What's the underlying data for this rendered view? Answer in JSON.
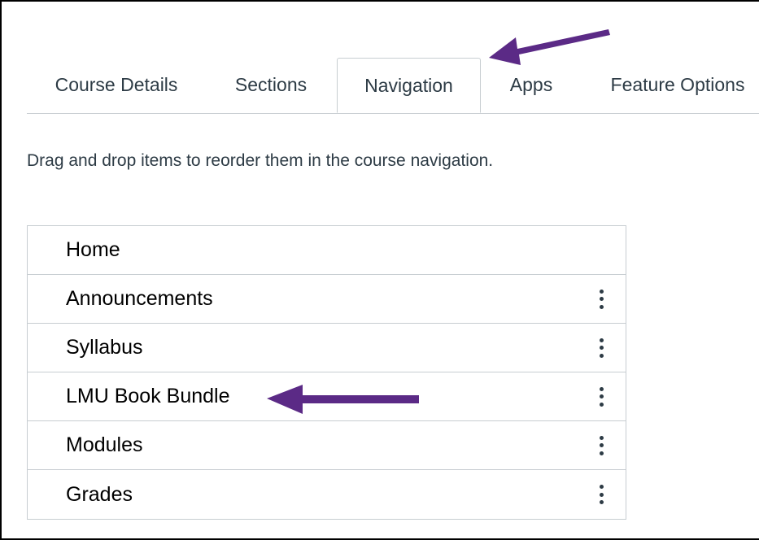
{
  "tabs": [
    {
      "label": "Course Details",
      "active": false
    },
    {
      "label": "Sections",
      "active": false
    },
    {
      "label": "Navigation",
      "active": true
    },
    {
      "label": "Apps",
      "active": false
    },
    {
      "label": "Feature Options",
      "active": false
    }
  ],
  "instructions": "Drag and drop items to reorder them in the course navigation.",
  "nav_items": [
    {
      "label": "Home",
      "has_menu": false
    },
    {
      "label": "Announcements",
      "has_menu": true
    },
    {
      "label": "Syllabus",
      "has_menu": true
    },
    {
      "label": "LMU Book Bundle",
      "has_menu": true
    },
    {
      "label": "Modules",
      "has_menu": true
    },
    {
      "label": "Grades",
      "has_menu": true
    }
  ],
  "colors": {
    "annotation_arrow": "#5b2a86",
    "border": "#c7cdd1",
    "text": "#2d3b45",
    "kebab_icon": "#2d3b45"
  },
  "icons": {
    "item_menu": "vertical-ellipsis-icon",
    "annotation": "arrow-pointer-icon"
  }
}
